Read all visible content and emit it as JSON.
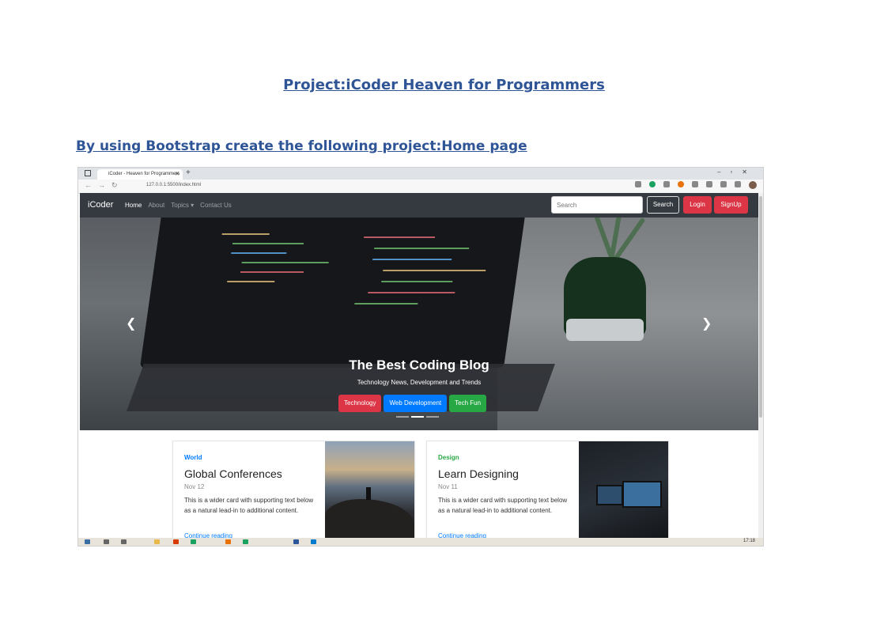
{
  "document": {
    "title": "Project:iCoder Heaven for Programmers",
    "subtitle": "By using Bootstrap create the following project:Home page"
  },
  "browser": {
    "tab_title": "iCoder - Heaven for Programmers",
    "url": "127.0.0.1:5500/index.html",
    "taskbar_time": "17:18"
  },
  "site": {
    "brand": "iCoder",
    "nav": [
      "Home",
      "About",
      "Topics ▾",
      "Contact Us"
    ],
    "search_placeholder": "Search",
    "search_button": "Search",
    "login_button": "Login",
    "signup_button": "SignUp",
    "hero": {
      "title": "The Best Coding Blog",
      "text": "Technology News, Development and Trends",
      "buttons": [
        "Technology",
        "Web Development",
        "Tech Fun"
      ]
    },
    "cards": [
      {
        "category": "World",
        "category_color": "#007bff",
        "title": "Global Conferences",
        "date": "Nov 12",
        "text": "This is a wider card with supporting text below as a natural lead-in to additional content.",
        "link": "Continue reading"
      },
      {
        "category": "Design",
        "category_color": "#28a745",
        "title": "Learn Designing",
        "date": "Nov 11",
        "text": "This is a wider card with supporting text below as a natural lead-in to additional content.",
        "link": "Continue reading"
      }
    ]
  }
}
